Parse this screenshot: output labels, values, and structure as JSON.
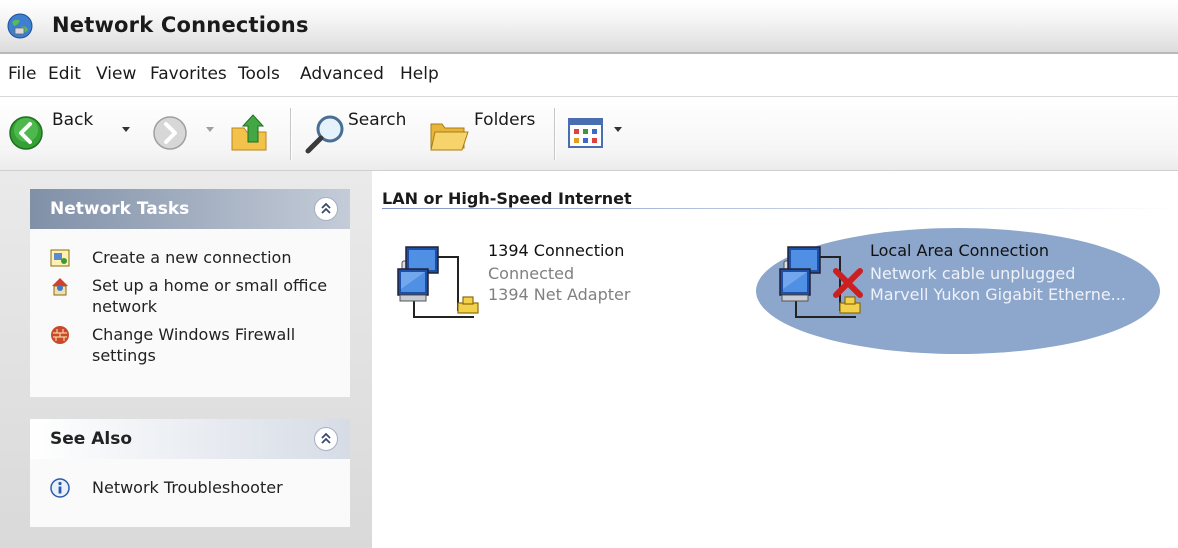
{
  "window": {
    "title": "Network Connections"
  },
  "menu": {
    "items": [
      "File",
      "Edit",
      "View",
      "Favorites",
      "Tools",
      "Advanced",
      "Help"
    ]
  },
  "toolbar": {
    "back_label": "Back",
    "search_label": "Search",
    "folders_label": "Folders"
  },
  "network_tasks": {
    "title": "Network Tasks",
    "tasks": [
      {
        "label": "Create a new connection",
        "icon": "new-connection-icon"
      },
      {
        "label": "Set up a home or small office network",
        "icon": "home-network-icon"
      },
      {
        "label": "Change Windows Firewall settings",
        "icon": "firewall-icon"
      }
    ]
  },
  "see_also": {
    "title": "See Also",
    "links": [
      {
        "label": "Network Troubleshooter",
        "icon": "info-icon"
      }
    ]
  },
  "content": {
    "group_header": "LAN or High-Speed Internet",
    "connections": [
      {
        "name": "1394 Connection",
        "status": "Connected",
        "device": "1394 Net Adapter",
        "icon": "network-connection-icon",
        "selected": false
      },
      {
        "name": "Local Area Connection",
        "status": "Network cable unplugged",
        "device": "Marvell Yukon Gigabit Etherne...",
        "icon": "network-disconnected-icon",
        "selected": true
      }
    ]
  },
  "colors": {
    "selection": "#8da6cc",
    "panel_header_dark": "#8090a8",
    "disconnect_x": "#cc1f1f"
  }
}
